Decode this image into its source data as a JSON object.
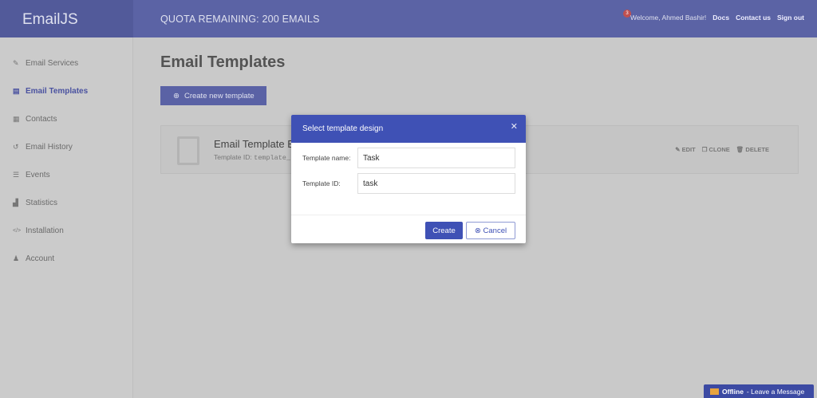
{
  "header": {
    "logo": "EmailJS",
    "quota": "QUOTA REMAINING: 200 EMAILS",
    "notification_count": "3",
    "welcome": "Welcome, Ahmed Bashir!",
    "links": [
      "Docs",
      "Contact us",
      "Sign out"
    ]
  },
  "sidebar": {
    "items": [
      {
        "label": "Email Services",
        "icon": "plug-icon",
        "glyph": "✎"
      },
      {
        "label": "Email Templates",
        "icon": "file-icon",
        "glyph": "▤"
      },
      {
        "label": "Contacts",
        "icon": "address-card-icon",
        "glyph": "▦"
      },
      {
        "label": "Email History",
        "icon": "history-icon",
        "glyph": "↺"
      },
      {
        "label": "Events",
        "icon": "list-icon",
        "glyph": "☰"
      },
      {
        "label": "Statistics",
        "icon": "chart-icon",
        "glyph": "▟"
      },
      {
        "label": "Installation",
        "icon": "code-icon",
        "glyph": "</>"
      },
      {
        "label": "Account",
        "icon": "user-icon",
        "glyph": "♟"
      }
    ]
  },
  "main": {
    "title": "Email Templates",
    "create_button": "Create new template",
    "template": {
      "name": "Email Template Ex",
      "id_label": "Template ID:",
      "id_value": "template_",
      "actions": [
        "EDIT",
        "CLONE",
        "DELETE"
      ]
    }
  },
  "modal": {
    "title": "Select template design",
    "name_label": "Template name:",
    "name_value": "Task",
    "id_label": "Template ID:",
    "id_value": "task",
    "create": "Create",
    "cancel": "Cancel"
  },
  "chat": {
    "status": "Offline",
    "text": " - Leave a Message"
  }
}
